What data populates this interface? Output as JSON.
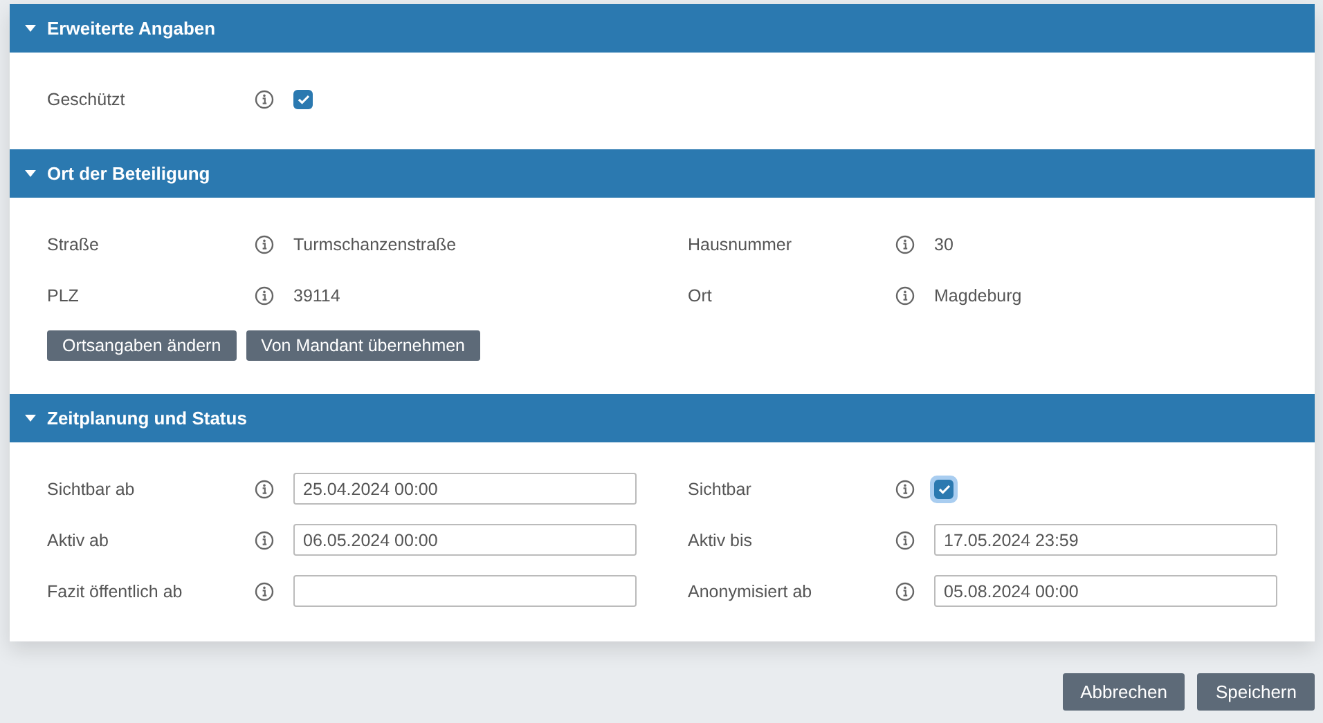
{
  "sections": [
    {
      "title": "Erweiterte Angaben",
      "expanded": true,
      "fields": [
        {
          "label": "Geschützt",
          "kind": "checkbox",
          "checked": true,
          "focused": false
        }
      ]
    },
    {
      "title": "Ort der Beteiligung",
      "expanded": true,
      "fields": [
        {
          "label": "Straße",
          "kind": "text",
          "value": "Turmschanzenstraße"
        },
        {
          "label": "Hausnummer",
          "kind": "text",
          "value": "30"
        },
        {
          "label": "PLZ",
          "kind": "text",
          "value": "39114"
        },
        {
          "label": "Ort",
          "kind": "text",
          "value": "Magdeburg"
        }
      ],
      "buttons": [
        "Ortsangaben ändern",
        "Von Mandant übernehmen"
      ]
    },
    {
      "title": "Zeitplanung und Status",
      "expanded": true,
      "fields": [
        {
          "label": "Sichtbar ab",
          "kind": "input",
          "value": "25.04.2024 00:00"
        },
        {
          "label": "Sichtbar",
          "kind": "checkbox",
          "checked": true,
          "focused": true
        },
        {
          "label": "Aktiv ab",
          "kind": "input",
          "value": "06.05.2024 00:00"
        },
        {
          "label": "Aktiv bis",
          "kind": "input",
          "value": "17.05.2024 23:59"
        },
        {
          "label": "Fazit öffentlich ab",
          "kind": "input"
        },
        {
          "label": "Anonymisiert ab",
          "kind": "input",
          "value": "05.08.2024 00:00"
        }
      ]
    }
  ],
  "footer_buttons": [
    "Abbrechen",
    "Speichern"
  ]
}
